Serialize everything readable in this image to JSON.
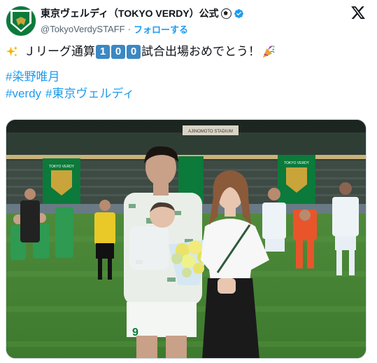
{
  "account": {
    "display_name": "東京ヴェルディ（TOKYO VERDY）公式",
    "handle": "@TokyoVerdySTAFF",
    "separator": "·",
    "follow_label": "フォローする",
    "verified": true
  },
  "icons": {
    "avatar": "tokyo-verdy-crest",
    "name_emoji": "soccer-ball-icon",
    "verified": "verified-badge-icon",
    "platform": "x-logo-icon",
    "sparkle": "sparkles-icon",
    "party": "party-popper-icon"
  },
  "tweet": {
    "line1_prefix": "Ｊリーグ通算",
    "line1_digits": [
      "1",
      "0",
      "0"
    ],
    "line1_suffix": "試合出場おめでとう！",
    "hashtag_player": "#染野唯月",
    "hashtag_verdy": "#verdy",
    "hashtag_tokyo_verdy": "#東京ヴェルディ"
  },
  "photo": {
    "stadium_sign": "AJINOMOTO STADIUM",
    "banner_text": "TOKYO VERDY",
    "shirt_number": "9"
  },
  "colors": {
    "link": "#1d9bf0",
    "verified": "#1d9bf0",
    "verdy_green": "#0b7a3b",
    "number_box": "#3b88c3",
    "text": "#0f1419",
    "secondary": "#536471"
  }
}
